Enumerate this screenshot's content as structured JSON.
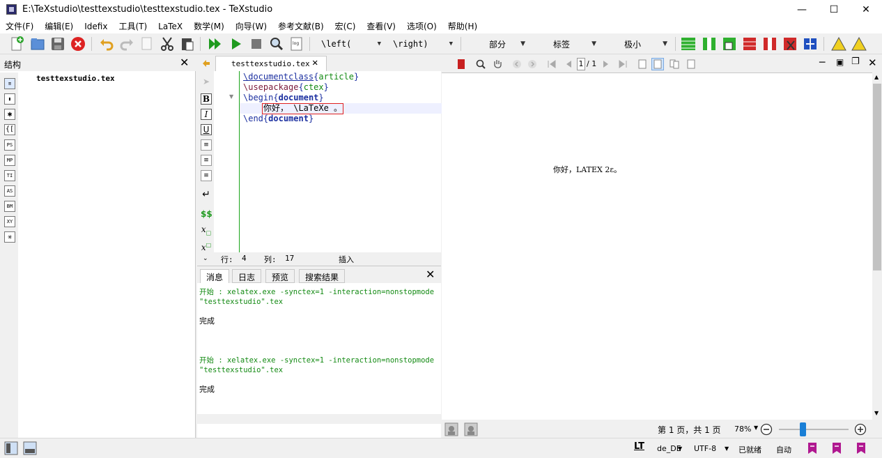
{
  "window": {
    "title": "E:\\TeXstudio\\testtexstudio\\testtexstudio.tex - TeXstudio"
  },
  "menu": [
    "文件(F)",
    "编辑(E)",
    "Idefix",
    "工具(T)",
    "LaTeX",
    "数学(M)",
    "向导(W)",
    "参考文献(B)",
    "宏(C)",
    "查看(V)",
    "选项(O)",
    "帮助(H)"
  ],
  "toolbar": {
    "left_combo": "\\left(",
    "right_combo": "\\right)",
    "section_combo": "部分",
    "label_combo": "标签",
    "size_combo": "极小"
  },
  "structure": {
    "title": "结构",
    "file": "testtexstudio.tex",
    "side_buttons": [
      "PS",
      "MP",
      "TI",
      "AS",
      "BM",
      "XY"
    ]
  },
  "editor": {
    "tab_label": "testtexstudio.tex",
    "lines": [
      {
        "cmd": "\\documentclass",
        "arg": "article"
      },
      {
        "cmd": "\\usepackage",
        "arg": "ctex"
      },
      {
        "cmd": "\\begin",
        "arg": "document"
      },
      {
        "text": "你好， \\LaTeXe 。"
      },
      {
        "cmd": "\\end",
        "arg": "document"
      }
    ],
    "status": {
      "row_label": "行:",
      "row": "4",
      "col_label": "列:",
      "col": "17",
      "mode": "插入"
    }
  },
  "messages": {
    "tabs": [
      "消息",
      "日志",
      "预览",
      "搜索结果"
    ],
    "entries": [
      "开始 : xelatex.exe -synctex=1 -interaction=nonstopmode\n\"testtexstudio\".tex",
      "完成",
      "开始 : xelatex.exe -synctex=1 -interaction=nonstopmode\n\"testtexstudio\".tex",
      "完成"
    ]
  },
  "pdf": {
    "page_current": "1",
    "page_total": "/ 1",
    "content": "你好，LATEX 2ε。",
    "page_info": "第 1 页，共 1 页",
    "zoom": "78%"
  },
  "statusbar": {
    "lt": "LT",
    "lang": "de_DE",
    "encoding": "UTF-8",
    "ready": "已就绪",
    "auto": "自动"
  }
}
